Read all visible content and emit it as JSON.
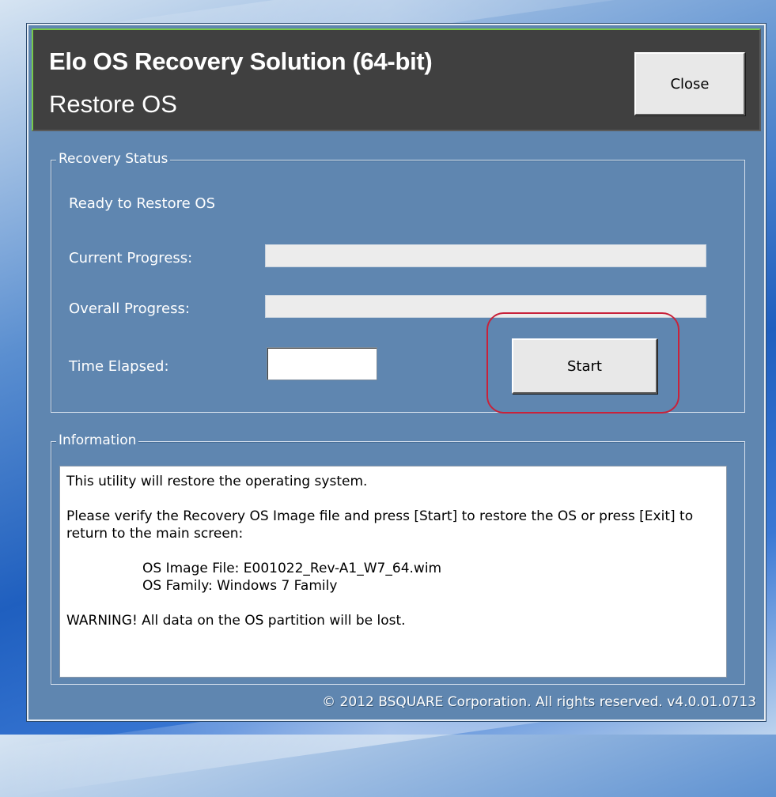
{
  "header": {
    "title": "Elo OS Recovery Solution (64-bit)",
    "subtitle": "Restore OS",
    "close_label": "Close"
  },
  "recovery_status": {
    "legend": "Recovery Status",
    "status_text": "Ready to Restore OS",
    "current_progress_label": "Current Progress:",
    "current_progress_value": 0,
    "overall_progress_label": "Overall Progress:",
    "overall_progress_value": 0,
    "time_elapsed_label": "Time Elapsed:",
    "time_elapsed_value": "",
    "start_label": "Start"
  },
  "information": {
    "legend": "Information",
    "line1": "This utility will restore the operating system.",
    "line2": "Please verify the Recovery OS Image file and press [Start] to restore the OS or press [Exit] to return to the main screen:",
    "image_file": "OS Image File: E001022_Rev-A1_W7_64.wim",
    "os_family": "OS Family: Windows 7 Family",
    "warning": "WARNING! All data on the OS partition will be lost."
  },
  "footer": {
    "copyright": "© 2012 BSQUARE Corporation. All rights reserved. v4.0.01.0713"
  },
  "colors": {
    "dialog_bg": "#5f86b0",
    "header_bg": "#404040",
    "header_accent": "#78c94a",
    "highlight": "#c8223a"
  }
}
